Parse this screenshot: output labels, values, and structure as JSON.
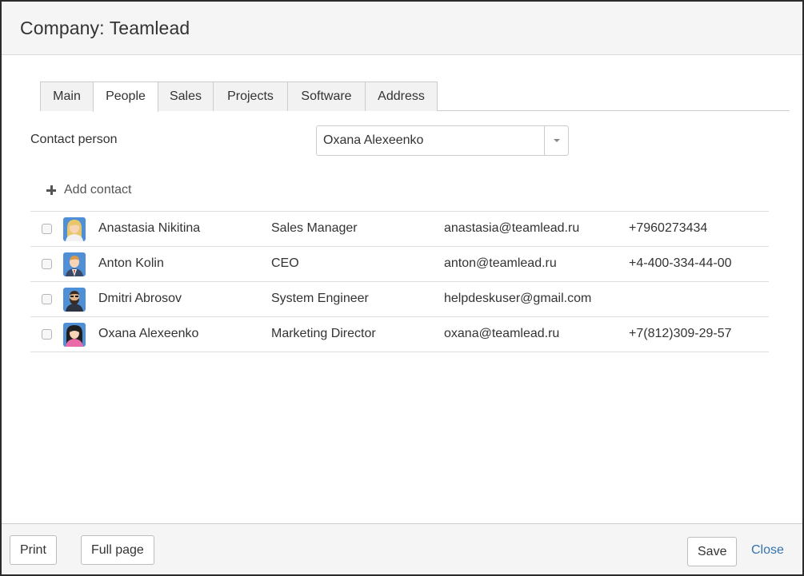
{
  "dialog": {
    "title": "Company: Teamlead"
  },
  "tabs": [
    {
      "label": "Main",
      "active": false
    },
    {
      "label": "People",
      "active": true
    },
    {
      "label": "Sales",
      "active": false
    },
    {
      "label": "Projects",
      "active": false
    },
    {
      "label": "Software",
      "active": false
    },
    {
      "label": "Address",
      "active": false
    }
  ],
  "contact_person": {
    "label": "Contact person",
    "selected": "Oxana Alexeenko"
  },
  "add_contact": {
    "label": "Add contact",
    "icon": "plus-icon"
  },
  "contacts": [
    {
      "name": "Anastasia Nikitina",
      "role": "Sales Manager",
      "email": "anastasia@teamlead.ru",
      "phone": "+7960273434",
      "checked": false,
      "avatar": "female-blonde-avatar"
    },
    {
      "name": "Anton Kolin",
      "role": "CEO",
      "email": "anton@teamlead.ru",
      "phone": "+4-400-334-44-00",
      "checked": false,
      "avatar": "male-suit-avatar"
    },
    {
      "name": "Dmitri Abrosov",
      "role": "System Engineer",
      "email": "helpdeskuser@gmail.com",
      "phone": "",
      "checked": false,
      "avatar": "male-bearded-avatar"
    },
    {
      "name": "Oxana Alexeenko",
      "role": "Marketing Director",
      "email": "oxana@teamlead.ru",
      "phone": "+7(812)309-29-57",
      "checked": false,
      "avatar": "female-dark-hair-avatar"
    }
  ],
  "footer": {
    "print_label": "Print",
    "full_page_label": "Full page",
    "save_label": "Save",
    "close_label": "Close"
  },
  "colors": {
    "link": "#3572b0",
    "header_bg": "#f5f5f5",
    "border": "#cccccc"
  }
}
